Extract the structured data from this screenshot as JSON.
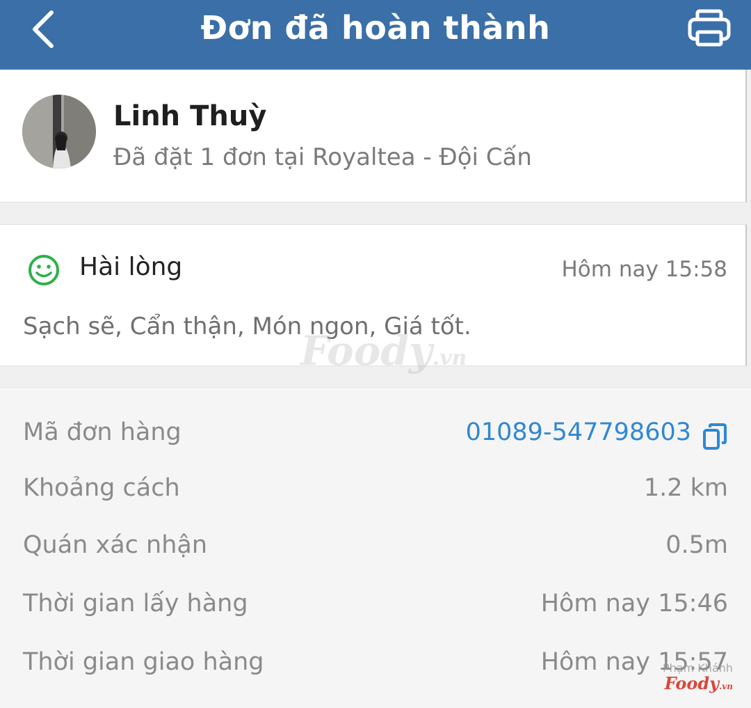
{
  "header": {
    "title": "Đơn đã hoàn thành",
    "back_icon": "chevron-left-icon",
    "print_icon": "printer-icon"
  },
  "user": {
    "name": "Linh Thuỳ",
    "subtitle": "Đã đặt 1 đơn tại Royaltea - Đội Cấn"
  },
  "rating": {
    "label": "Hài lòng",
    "time": "Hôm nay 15:58",
    "comment": "Sạch sẽ, Cẩn thận, Món ngon, Giá tốt.",
    "icon": "smile-icon",
    "icon_color": "#2db04a"
  },
  "details": {
    "order_id": {
      "label": "Mã đơn hàng",
      "value": "01089-547798603"
    },
    "distance": {
      "label": "Khoảng cách",
      "value": "1.2 km"
    },
    "confirm": {
      "label": "Quán xác nhận",
      "value": "0.5m"
    },
    "pickup": {
      "label": "Thời gian lấy hàng",
      "value": "Hôm nay 15:46"
    },
    "delivery": {
      "label": "Thời gian giao hàng",
      "value": "Hôm nay 15:57"
    }
  },
  "watermark": {
    "brand": "Foody",
    "brand_suffix": ".vn",
    "author": "Phạm Khánh"
  },
  "colors": {
    "header_bg": "#3a6fa8",
    "link": "#2f87d4",
    "brand_red": "#d8473a"
  }
}
